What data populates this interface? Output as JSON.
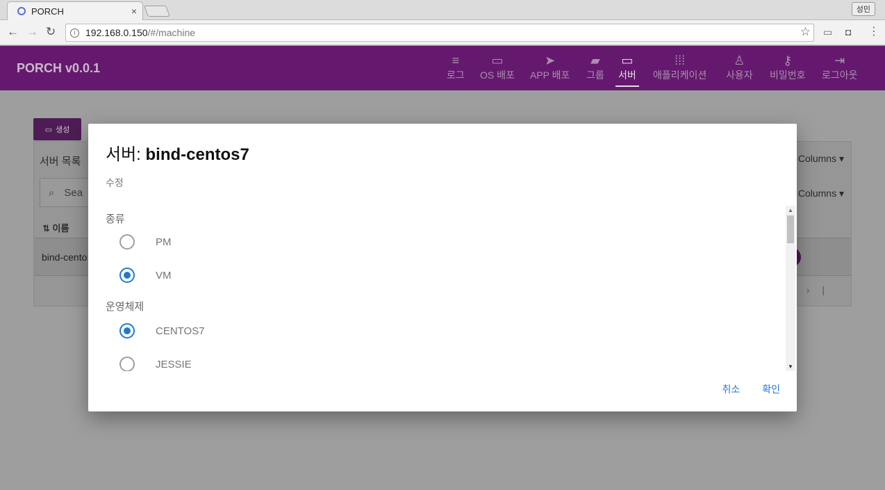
{
  "browser": {
    "tab_title": "PORCH",
    "tab_close": "×",
    "profile": "성민",
    "url_host": "192.168.0.150",
    "url_path": "/#/machine"
  },
  "appbar": {
    "brand": "PORCH v0.0.1",
    "nav": [
      {
        "label": "로그",
        "icon": "list-icon"
      },
      {
        "label": "OS 배포",
        "icon": "cast-icon"
      },
      {
        "label": "APP 배포",
        "icon": "send-icon"
      },
      {
        "label": "그룹",
        "icon": "folder-add-icon"
      },
      {
        "label": "서버",
        "icon": "laptop-icon"
      },
      {
        "label": "애플리케이션",
        "icon": "apps-grid-icon"
      },
      {
        "label": "사용자",
        "icon": "person-icon"
      },
      {
        "label": "비밀번호",
        "icon": "key-icon"
      },
      {
        "label": "로그아웃",
        "icon": "exit-icon"
      }
    ],
    "active": "서버"
  },
  "page": {
    "create_label": "생성",
    "panel_title": "서버 목록",
    "columns_label": "Columns",
    "search_placeholder": "Sea",
    "sort_column": "이름",
    "row_name": "bind-cento"
  },
  "dialog": {
    "title_prefix": "서버: ",
    "title_name": "bind-centos7",
    "subtitle": "수정",
    "type_label": "종류",
    "type_options": [
      "PM",
      "VM"
    ],
    "type_selected": "VM",
    "os_label": "운영체제",
    "os_options": [
      "CENTOS7",
      "JESSIE"
    ],
    "os_selected": "CENTOS7",
    "cancel_label": "취소",
    "ok_label": "확인"
  },
  "colors": {
    "appbar": "#65196e",
    "accent": "#1e7ad6",
    "overlay": "#9e9e9e"
  }
}
